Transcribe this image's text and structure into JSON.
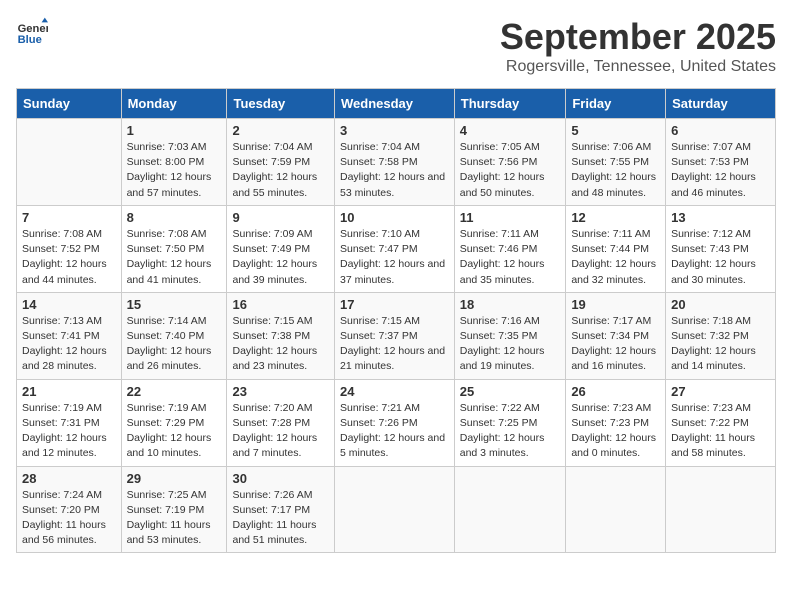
{
  "logo": {
    "line1": "General",
    "line2": "Blue"
  },
  "title": "September 2025",
  "subtitle": "Rogersville, Tennessee, United States",
  "days_header": [
    "Sunday",
    "Monday",
    "Tuesday",
    "Wednesday",
    "Thursday",
    "Friday",
    "Saturday"
  ],
  "weeks": [
    [
      {
        "day": "",
        "sunrise": "",
        "sunset": "",
        "daylight": ""
      },
      {
        "day": "1",
        "sunrise": "Sunrise: 7:03 AM",
        "sunset": "Sunset: 8:00 PM",
        "daylight": "Daylight: 12 hours and 57 minutes."
      },
      {
        "day": "2",
        "sunrise": "Sunrise: 7:04 AM",
        "sunset": "Sunset: 7:59 PM",
        "daylight": "Daylight: 12 hours and 55 minutes."
      },
      {
        "day": "3",
        "sunrise": "Sunrise: 7:04 AM",
        "sunset": "Sunset: 7:58 PM",
        "daylight": "Daylight: 12 hours and 53 minutes."
      },
      {
        "day": "4",
        "sunrise": "Sunrise: 7:05 AM",
        "sunset": "Sunset: 7:56 PM",
        "daylight": "Daylight: 12 hours and 50 minutes."
      },
      {
        "day": "5",
        "sunrise": "Sunrise: 7:06 AM",
        "sunset": "Sunset: 7:55 PM",
        "daylight": "Daylight: 12 hours and 48 minutes."
      },
      {
        "day": "6",
        "sunrise": "Sunrise: 7:07 AM",
        "sunset": "Sunset: 7:53 PM",
        "daylight": "Daylight: 12 hours and 46 minutes."
      }
    ],
    [
      {
        "day": "7",
        "sunrise": "Sunrise: 7:08 AM",
        "sunset": "Sunset: 7:52 PM",
        "daylight": "Daylight: 12 hours and 44 minutes."
      },
      {
        "day": "8",
        "sunrise": "Sunrise: 7:08 AM",
        "sunset": "Sunset: 7:50 PM",
        "daylight": "Daylight: 12 hours and 41 minutes."
      },
      {
        "day": "9",
        "sunrise": "Sunrise: 7:09 AM",
        "sunset": "Sunset: 7:49 PM",
        "daylight": "Daylight: 12 hours and 39 minutes."
      },
      {
        "day": "10",
        "sunrise": "Sunrise: 7:10 AM",
        "sunset": "Sunset: 7:47 PM",
        "daylight": "Daylight: 12 hours and 37 minutes."
      },
      {
        "day": "11",
        "sunrise": "Sunrise: 7:11 AM",
        "sunset": "Sunset: 7:46 PM",
        "daylight": "Daylight: 12 hours and 35 minutes."
      },
      {
        "day": "12",
        "sunrise": "Sunrise: 7:11 AM",
        "sunset": "Sunset: 7:44 PM",
        "daylight": "Daylight: 12 hours and 32 minutes."
      },
      {
        "day": "13",
        "sunrise": "Sunrise: 7:12 AM",
        "sunset": "Sunset: 7:43 PM",
        "daylight": "Daylight: 12 hours and 30 minutes."
      }
    ],
    [
      {
        "day": "14",
        "sunrise": "Sunrise: 7:13 AM",
        "sunset": "Sunset: 7:41 PM",
        "daylight": "Daylight: 12 hours and 28 minutes."
      },
      {
        "day": "15",
        "sunrise": "Sunrise: 7:14 AM",
        "sunset": "Sunset: 7:40 PM",
        "daylight": "Daylight: 12 hours and 26 minutes."
      },
      {
        "day": "16",
        "sunrise": "Sunrise: 7:15 AM",
        "sunset": "Sunset: 7:38 PM",
        "daylight": "Daylight: 12 hours and 23 minutes."
      },
      {
        "day": "17",
        "sunrise": "Sunrise: 7:15 AM",
        "sunset": "Sunset: 7:37 PM",
        "daylight": "Daylight: 12 hours and 21 minutes."
      },
      {
        "day": "18",
        "sunrise": "Sunrise: 7:16 AM",
        "sunset": "Sunset: 7:35 PM",
        "daylight": "Daylight: 12 hours and 19 minutes."
      },
      {
        "day": "19",
        "sunrise": "Sunrise: 7:17 AM",
        "sunset": "Sunset: 7:34 PM",
        "daylight": "Daylight: 12 hours and 16 minutes."
      },
      {
        "day": "20",
        "sunrise": "Sunrise: 7:18 AM",
        "sunset": "Sunset: 7:32 PM",
        "daylight": "Daylight: 12 hours and 14 minutes."
      }
    ],
    [
      {
        "day": "21",
        "sunrise": "Sunrise: 7:19 AM",
        "sunset": "Sunset: 7:31 PM",
        "daylight": "Daylight: 12 hours and 12 minutes."
      },
      {
        "day": "22",
        "sunrise": "Sunrise: 7:19 AM",
        "sunset": "Sunset: 7:29 PM",
        "daylight": "Daylight: 12 hours and 10 minutes."
      },
      {
        "day": "23",
        "sunrise": "Sunrise: 7:20 AM",
        "sunset": "Sunset: 7:28 PM",
        "daylight": "Daylight: 12 hours and 7 minutes."
      },
      {
        "day": "24",
        "sunrise": "Sunrise: 7:21 AM",
        "sunset": "Sunset: 7:26 PM",
        "daylight": "Daylight: 12 hours and 5 minutes."
      },
      {
        "day": "25",
        "sunrise": "Sunrise: 7:22 AM",
        "sunset": "Sunset: 7:25 PM",
        "daylight": "Daylight: 12 hours and 3 minutes."
      },
      {
        "day": "26",
        "sunrise": "Sunrise: 7:23 AM",
        "sunset": "Sunset: 7:23 PM",
        "daylight": "Daylight: 12 hours and 0 minutes."
      },
      {
        "day": "27",
        "sunrise": "Sunrise: 7:23 AM",
        "sunset": "Sunset: 7:22 PM",
        "daylight": "Daylight: 11 hours and 58 minutes."
      }
    ],
    [
      {
        "day": "28",
        "sunrise": "Sunrise: 7:24 AM",
        "sunset": "Sunset: 7:20 PM",
        "daylight": "Daylight: 11 hours and 56 minutes."
      },
      {
        "day": "29",
        "sunrise": "Sunrise: 7:25 AM",
        "sunset": "Sunset: 7:19 PM",
        "daylight": "Daylight: 11 hours and 53 minutes."
      },
      {
        "day": "30",
        "sunrise": "Sunrise: 7:26 AM",
        "sunset": "Sunset: 7:17 PM",
        "daylight": "Daylight: 11 hours and 51 minutes."
      },
      {
        "day": "",
        "sunrise": "",
        "sunset": "",
        "daylight": ""
      },
      {
        "day": "",
        "sunrise": "",
        "sunset": "",
        "daylight": ""
      },
      {
        "day": "",
        "sunrise": "",
        "sunset": "",
        "daylight": ""
      },
      {
        "day": "",
        "sunrise": "",
        "sunset": "",
        "daylight": ""
      }
    ]
  ]
}
